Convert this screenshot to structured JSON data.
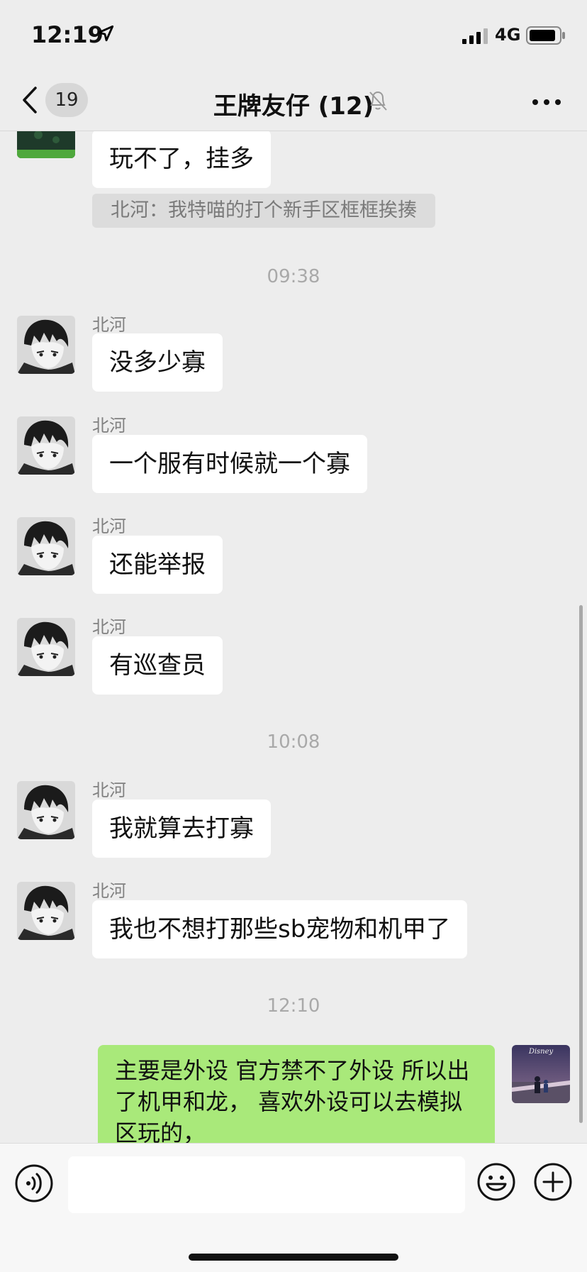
{
  "status_bar": {
    "time": "12:19",
    "network": "4G",
    "icons": [
      "location-icon",
      "signal-icon",
      "battery-icon"
    ]
  },
  "nav": {
    "back_icon": "chevron-left-icon",
    "unread_count": "19",
    "title": "王牌友仔 (12)",
    "mute_icon": "bell-off-icon",
    "more_icon": "more-icon"
  },
  "messages": {
    "m0": {
      "text": "玩不了，挂多"
    },
    "quote": {
      "text": "北河：我特喵的打个新手区框框挨揍"
    },
    "ts1": "09:38",
    "m1": {
      "sender": "北河",
      "text": "没多少寡"
    },
    "m2": {
      "sender": "北河",
      "text": "一个服有时候就一个寡"
    },
    "m3": {
      "sender": "北河",
      "text": "还能举报"
    },
    "m4": {
      "sender": "北河",
      "text": "有巡查员"
    },
    "ts2": "10:08",
    "m5": {
      "sender": "北河",
      "text": "我就算去打寡"
    },
    "m6": {
      "sender": "北河",
      "text": "我也不想打那些sb宠物和机甲了"
    },
    "ts3": "12:10",
    "m7": {
      "text": "主要是外设  官方禁不了外设 所以出了机甲和龙， 喜欢外设可以去模拟区玩的，"
    },
    "my_avatar_text": "Disney"
  },
  "input_bar": {
    "icons": [
      "voice-icon",
      "emoji-icon",
      "plus-icon"
    ],
    "placeholder": ""
  },
  "colors": {
    "background": "#ededed",
    "my_bubble": "#a9e97a",
    "other_bubble": "#ffffff"
  }
}
